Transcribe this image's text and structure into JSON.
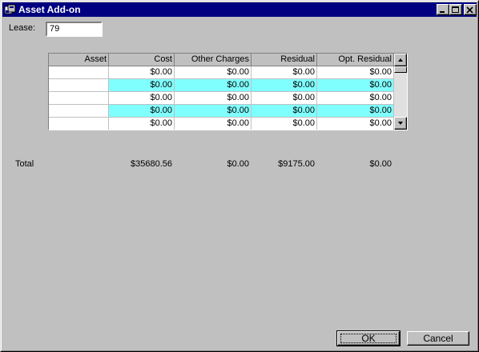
{
  "window": {
    "title": "Asset Add-on"
  },
  "titlebar_buttons": {
    "minimize": "minimize-icon",
    "maximize": "maximize-icon",
    "close": "close-icon"
  },
  "lease": {
    "label": "Lease:",
    "value": "79"
  },
  "grid": {
    "columns": [
      "Asset",
      "Cost",
      "Other Charges",
      "Residual",
      "Opt. Residual"
    ],
    "rows": [
      [
        "",
        "$0.00",
        "$0.00",
        "$0.00",
        "$0.00"
      ],
      [
        "",
        "$0.00",
        "$0.00",
        "$0.00",
        "$0.00"
      ],
      [
        "",
        "$0.00",
        "$0.00",
        "$0.00",
        "$0.00"
      ],
      [
        "",
        "$0.00",
        "$0.00",
        "$0.00",
        "$0.00"
      ],
      [
        "",
        "$0.00",
        "$0.00",
        "$0.00",
        "$0.00"
      ]
    ],
    "row_colors": [
      "#ffffff",
      "#80ffff"
    ]
  },
  "totals": {
    "label": "Total",
    "cost": "$35680.56",
    "other_charges": "$0.00",
    "residual": "$9175.00",
    "opt_residual": "$0.00"
  },
  "buttons": {
    "ok": "OK",
    "cancel": "Cancel"
  },
  "colors": {
    "titlebar": "#000080",
    "face": "#c0c0c0",
    "highlight_row": "#80ffff"
  }
}
